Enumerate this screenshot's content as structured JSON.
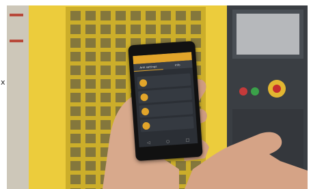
{
  "stray_text": "x",
  "app": {
    "header_title": "",
    "tabs": [
      "Anti settings",
      "Info"
    ],
    "section_label": "",
    "menu_items": [
      "",
      "",
      "",
      ""
    ]
  },
  "nav_icons": [
    "back-icon",
    "home-icon",
    "recent-apps-icon"
  ],
  "colors": {
    "machine_yellow": "#e8c21c",
    "app_accent": "#e2a52a",
    "screen_bg": "#2b2f35",
    "panel_dark": "#2a2e33"
  }
}
